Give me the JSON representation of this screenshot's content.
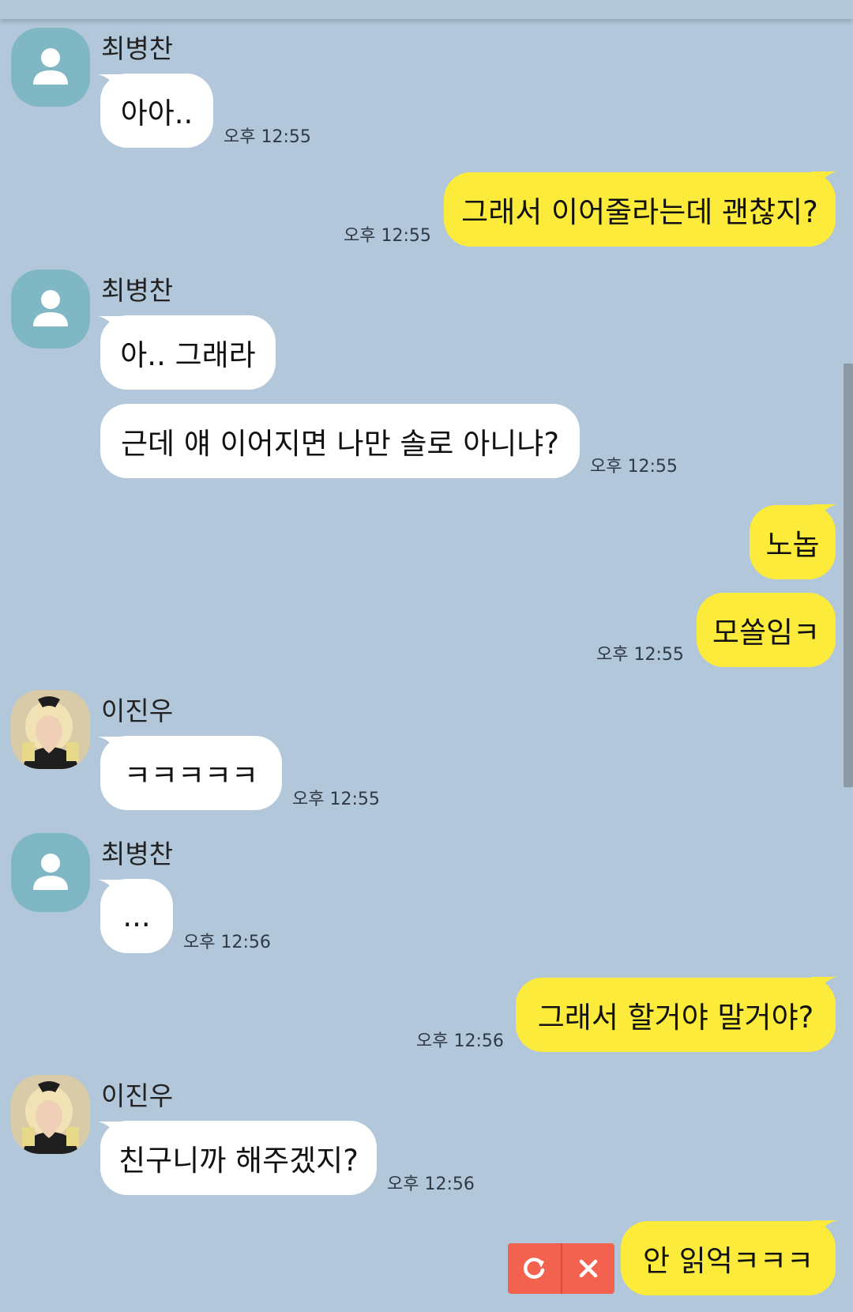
{
  "colors": {
    "background": "#b2c7da",
    "incoming_bubble": "#ffffff",
    "outgoing_bubble": "#fdeb3b",
    "default_avatar": "#7fb7c4",
    "failed_action": "#f3624f"
  },
  "messages": [
    {
      "sender": "최병찬",
      "avatar": "person-silhouette-icon",
      "text": "아아..",
      "time": "오후 12:55"
    },
    {
      "sender": "me",
      "text": "그래서 이어줄라는데 괜찮지?",
      "time": "오후 12:55"
    },
    {
      "sender": "최병찬",
      "avatar": "person-silhouette-icon",
      "text": "아.. 그래라"
    },
    {
      "sender": "최병찬",
      "text": "근데 얘 이어지면 나만 솔로 아니냐?",
      "time": "오후 12:55"
    },
    {
      "sender": "me",
      "text": "노놉"
    },
    {
      "sender": "me",
      "text": "모쏠임ㅋ",
      "time": "오후 12:55"
    },
    {
      "sender": "이진우",
      "avatar": "profile-photo",
      "text": "ㅋㅋㅋㅋㅋ",
      "time": "오후 12:55"
    },
    {
      "sender": "최병찬",
      "avatar": "person-silhouette-icon",
      "text": "...",
      "time": "오후 12:56"
    },
    {
      "sender": "me",
      "text": "그래서 할거야 말거야?",
      "time": "오후 12:56"
    },
    {
      "sender": "이진우",
      "avatar": "profile-photo",
      "text": "친구니까 해주겠지?",
      "time": "오후 12:56"
    },
    {
      "sender": "me",
      "text": "안 읽억ㅋㅋㅋ",
      "status": "failed",
      "actions": [
        "retry-icon",
        "close-icon"
      ]
    }
  ]
}
